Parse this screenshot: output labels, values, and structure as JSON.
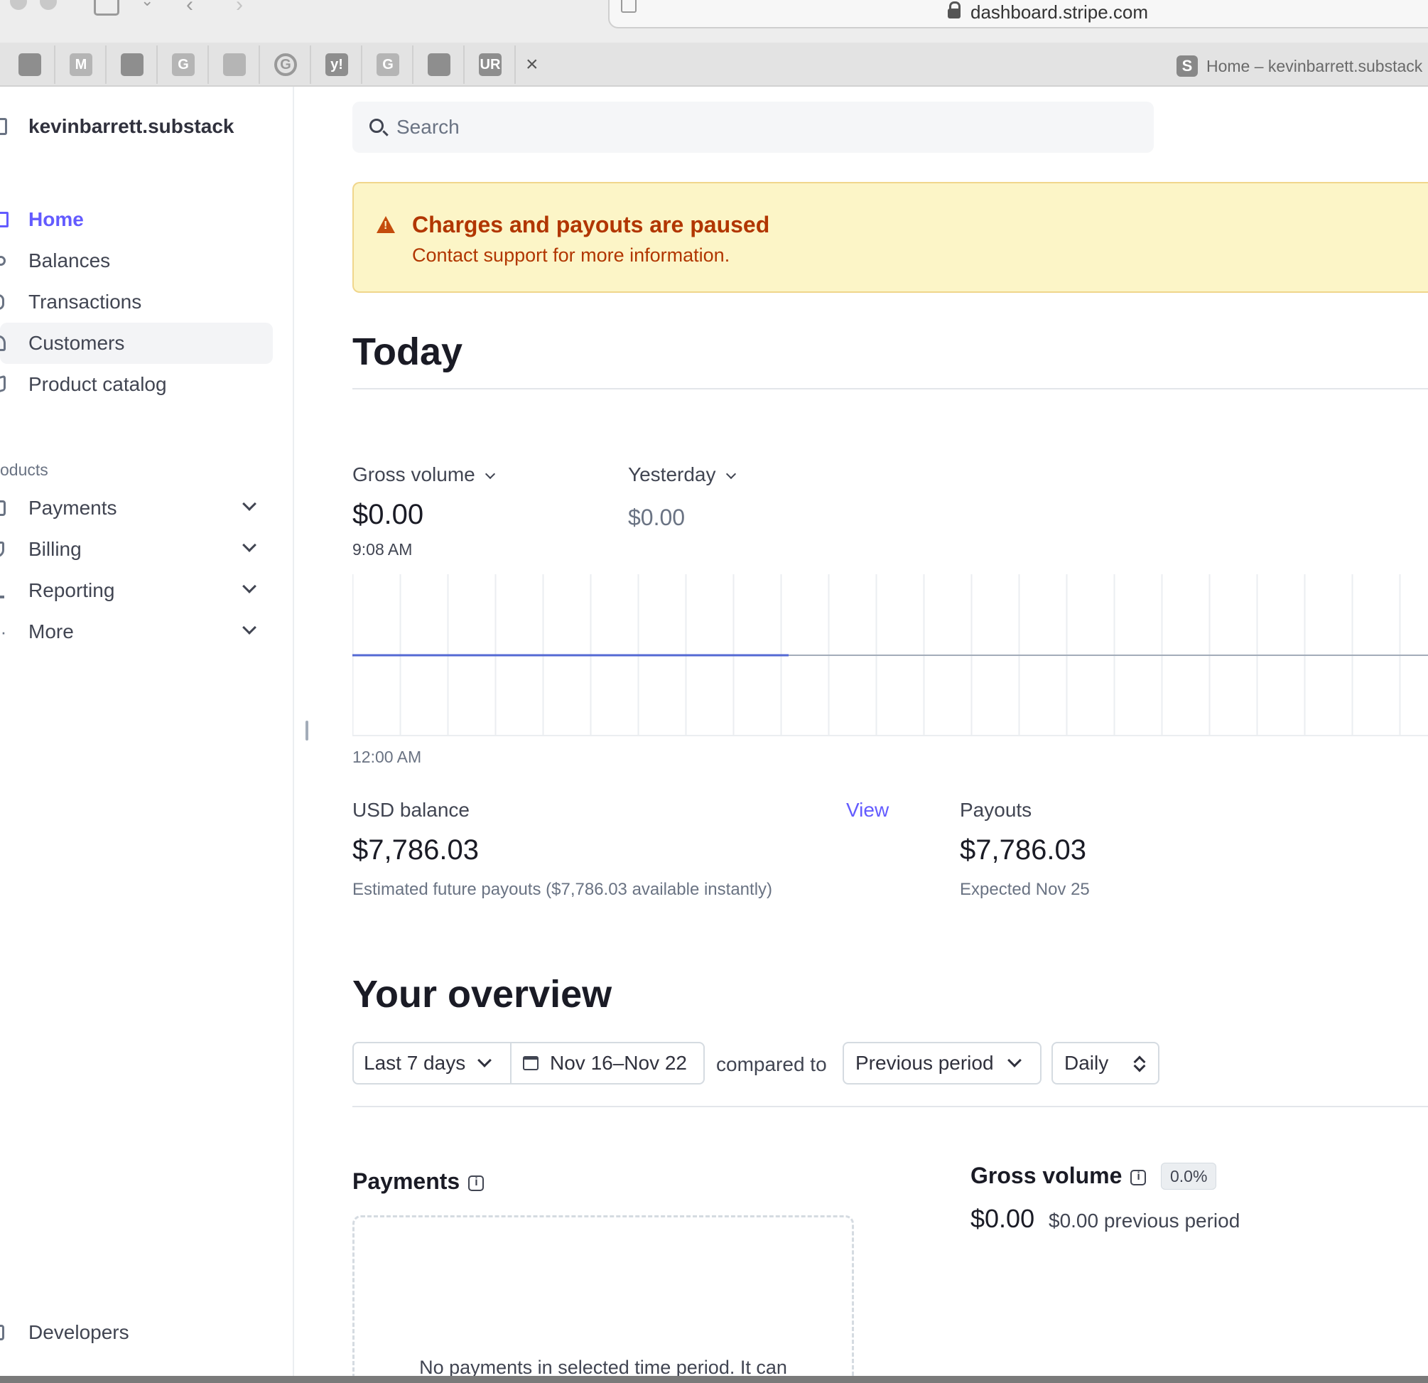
{
  "browser": {
    "url": "dashboard.stripe.com",
    "active_tab_title": "Home – kevinbarrett.substack",
    "active_tab_favicon": "S",
    "pinned_tabs": [
      {
        "glyph": "",
        "style": "dark"
      },
      {
        "glyph": "M",
        "style": "light"
      },
      {
        "glyph": "",
        "style": "dark"
      },
      {
        "glyph": "G",
        "style": "light"
      },
      {
        "glyph": "",
        "style": "light"
      },
      {
        "glyph": "G",
        "style": "circle"
      },
      {
        "glyph": "y!",
        "style": "dark"
      },
      {
        "glyph": "G",
        "style": "light"
      },
      {
        "glyph": "",
        "style": "dark"
      },
      {
        "glyph": "UR",
        "style": "dark"
      }
    ],
    "close_glyph": "×"
  },
  "sidebar": {
    "account_name": "kevinbarrett.substack",
    "items": [
      {
        "label": "Home",
        "icon": "home-icon",
        "active": true
      },
      {
        "label": "Balances",
        "icon": "balances-icon"
      },
      {
        "label": "Transactions",
        "icon": "transactions-icon"
      },
      {
        "label": "Customers",
        "icon": "customers-icon",
        "hover": true
      },
      {
        "label": "Product catalog",
        "icon": "product-catalog-icon"
      }
    ],
    "section_label": "oducts",
    "product_items": [
      {
        "label": "Payments",
        "icon": "payments-icon"
      },
      {
        "label": "Billing",
        "icon": "billing-icon"
      },
      {
        "label": "Reporting",
        "icon": "reporting-icon"
      },
      {
        "label": "More",
        "icon": "more-icon"
      }
    ],
    "developers_label": "Developers"
  },
  "search": {
    "placeholder": "Search"
  },
  "banner": {
    "title": "Charges and payouts are paused",
    "subtitle": "Contact support for more information."
  },
  "today": {
    "heading": "Today",
    "gross_volume_label": "Gross volume",
    "gross_volume_value": "$0.00",
    "gross_volume_time": "9:08 AM",
    "compare_label": "Yesterday",
    "compare_value": "$0.00",
    "chart_start_label": "12:00 AM",
    "usd_balance_label": "USD balance",
    "usd_balance_view": "View",
    "usd_balance_value": "$7,786.03",
    "usd_balance_desc": "Estimated future payouts ($7,786.03 available instantly)",
    "payouts_label": "Payouts",
    "payouts_value": "$7,786.03",
    "payouts_desc": "Expected Nov 25"
  },
  "overview": {
    "heading": "Your overview",
    "range_select": "Last 7 days",
    "date_range": "Nov 16–Nov 22",
    "compared_to_text": "compared to",
    "compare_select": "Previous period",
    "interval_select": "Daily",
    "payments_title": "Payments",
    "payments_empty": "No payments in selected time period. It can",
    "gross_volume_title": "Gross volume",
    "gross_volume_change": "0.0%",
    "gross_volume_value": "$0.00",
    "gross_volume_previous": "$0.00 previous period"
  },
  "colors": {
    "accent": "#635bff",
    "warning_bg": "#fcf5c7",
    "warning_text": "#b13600",
    "today_line": "#5469d4",
    "yesterday_line": "#a3acb9"
  }
}
